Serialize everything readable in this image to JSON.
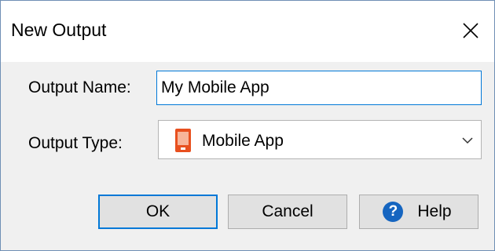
{
  "dialog": {
    "title": "New Output"
  },
  "form": {
    "name_label": "Output Name:",
    "name_value": "My Mobile App",
    "type_label": "Output Type:",
    "type_value": "Mobile App",
    "type_icon": "mobile-app-icon"
  },
  "buttons": {
    "ok": "OK",
    "cancel": "Cancel",
    "help": "Help",
    "help_icon_glyph": "?"
  },
  "colors": {
    "accent": "#0078d7",
    "mobile_icon_orange": "#e8501f",
    "help_icon_blue": "#1565c0"
  }
}
